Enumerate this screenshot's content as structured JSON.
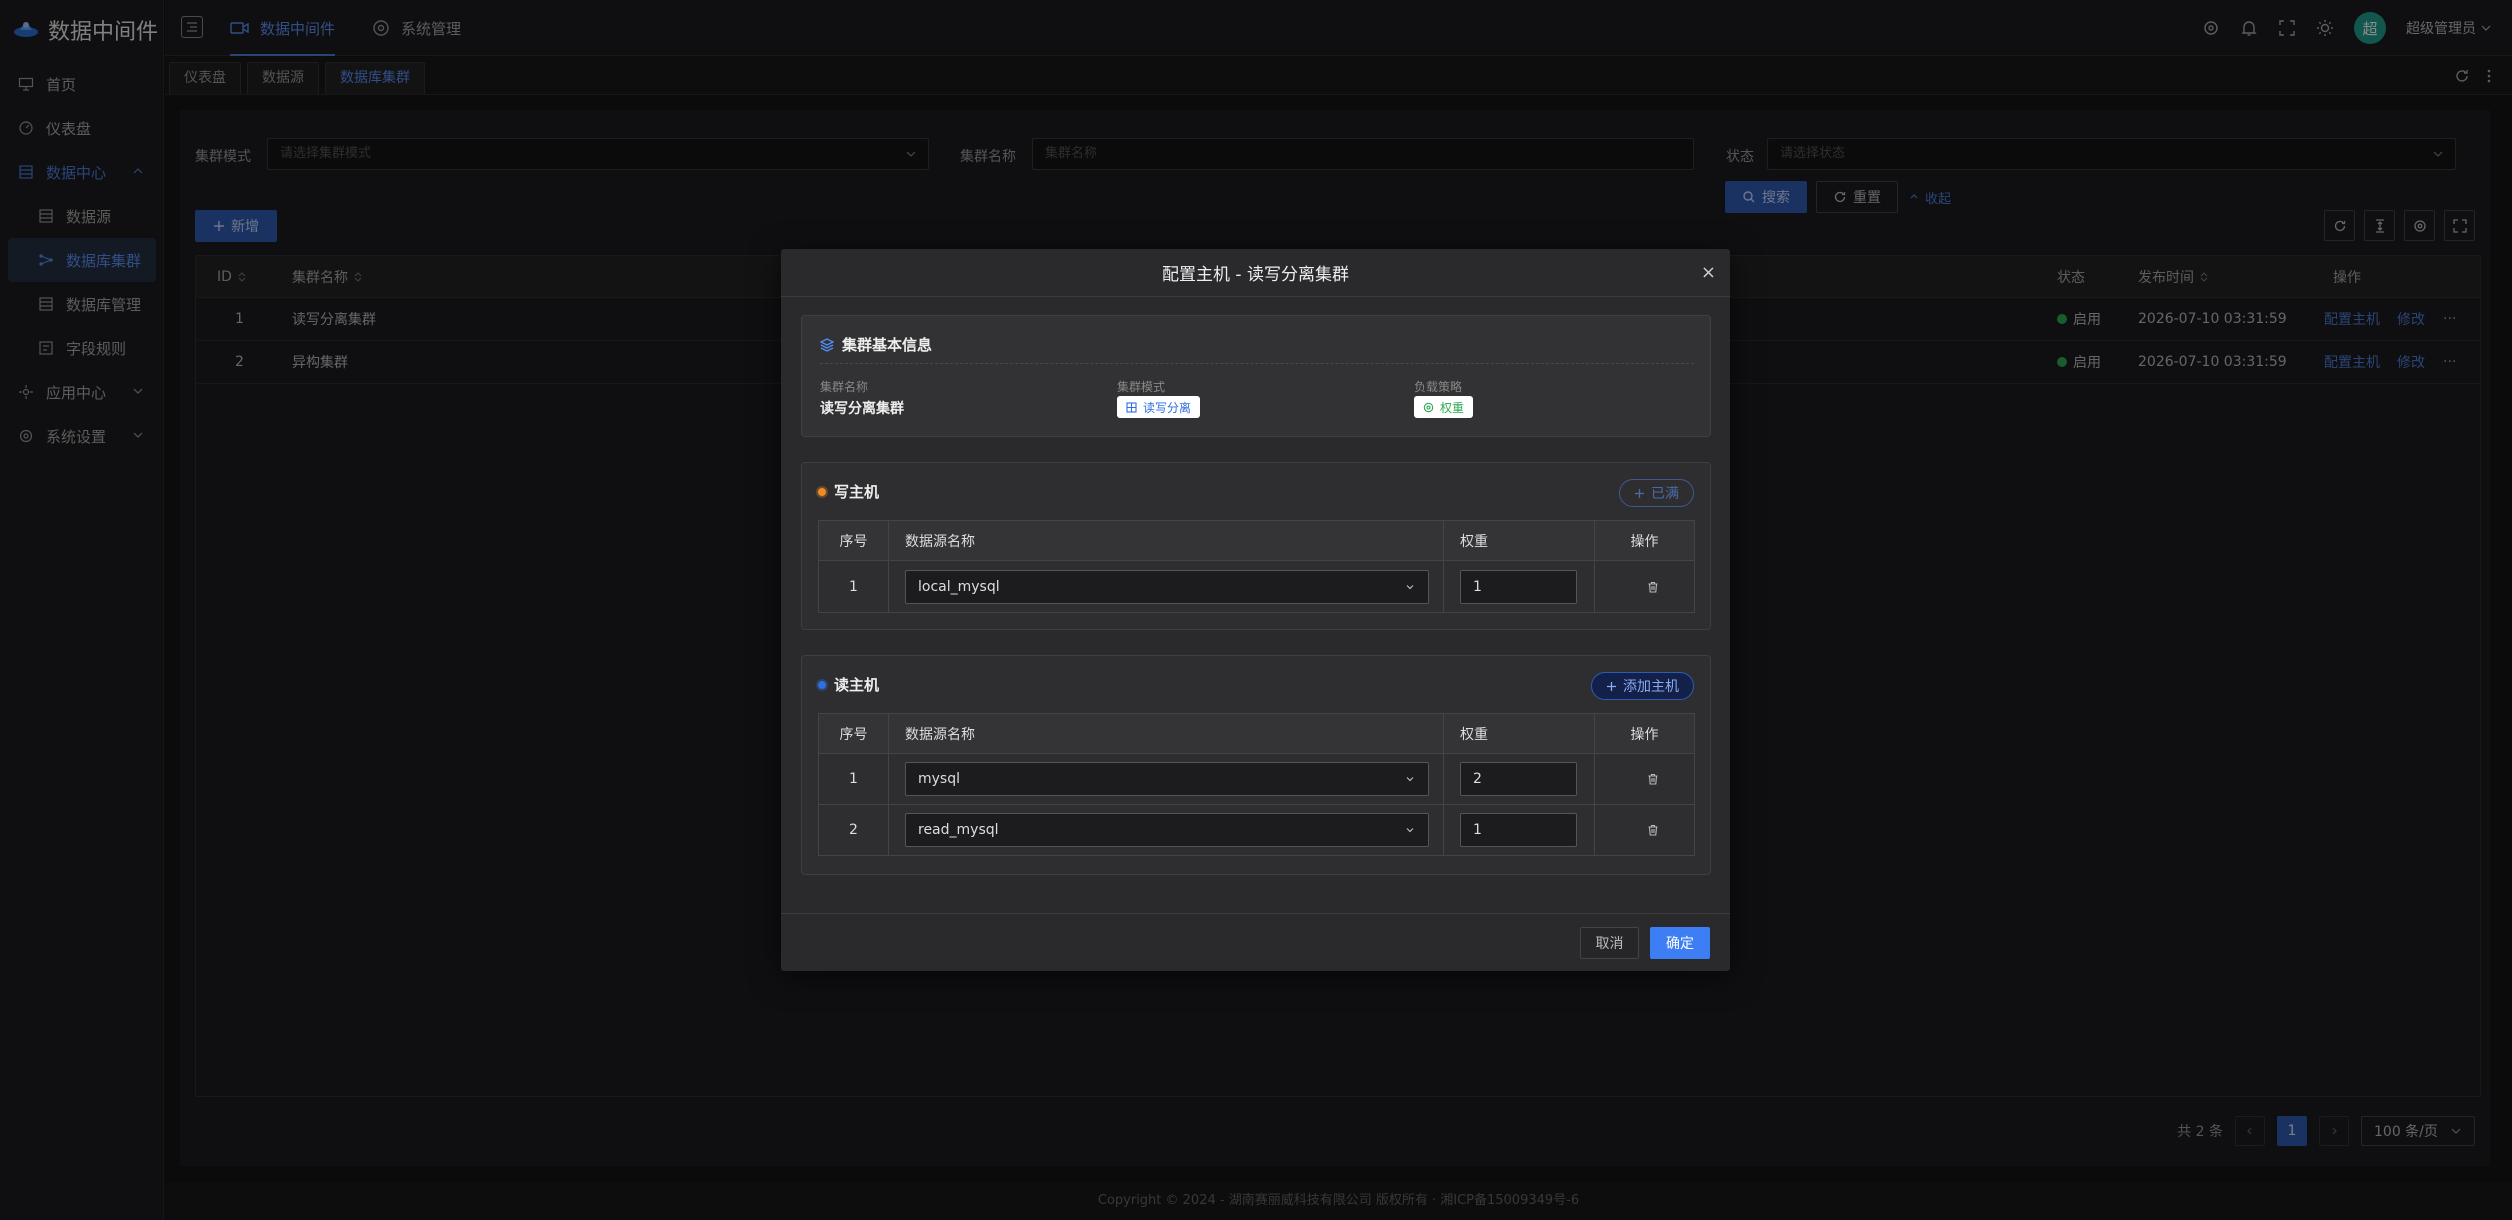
{
  "app": {
    "title": "数据中间件"
  },
  "sidebar": {
    "items": [
      {
        "label": "首页",
        "icon": "monitor-icon"
      },
      {
        "label": "仪表盘",
        "icon": "dashboard-icon"
      },
      {
        "label": "数据中心",
        "icon": "database-icon"
      },
      {
        "label": "数据源",
        "icon": "table-icon"
      },
      {
        "label": "数据库集群",
        "icon": "cluster-icon"
      },
      {
        "label": "数据库管理",
        "icon": "table-icon"
      },
      {
        "label": "字段规则",
        "icon": "rule-icon"
      },
      {
        "label": "应用中心",
        "icon": "apps-icon"
      },
      {
        "label": "系统设置",
        "icon": "gear-icon"
      }
    ]
  },
  "topnav": {
    "items": [
      {
        "label": "数据中间件"
      },
      {
        "label": "系统管理"
      }
    ]
  },
  "user": {
    "avatar": "超",
    "name": "超级管理员"
  },
  "tabs": [
    {
      "label": "仪表盘"
    },
    {
      "label": "数据源"
    },
    {
      "label": "数据库集群"
    }
  ],
  "search": {
    "mode_label": "集群模式",
    "mode_placeholder": "请选择集群模式",
    "name_label": "集群名称",
    "name_placeholder": "集群名称",
    "status_label": "状态",
    "status_placeholder": "请选择状态",
    "search_btn": "搜索",
    "reset_btn": "重置",
    "collapse_btn": "收起"
  },
  "toolbar": {
    "add_btn": "新增"
  },
  "table": {
    "headers": {
      "id": "ID",
      "name": "集群名称",
      "status": "状态",
      "time": "发布时间",
      "ops": "操作"
    },
    "rows": [
      {
        "id": "1",
        "name": "读写分离集群",
        "status": "启用",
        "time": "2026-07-10 03:31:59",
        "op1": "配置主机",
        "op2": "修改",
        "more": "···"
      },
      {
        "id": "2",
        "name": "异构集群",
        "status": "启用",
        "time": "2026-07-10 03:31:59",
        "op1": "配置主机",
        "op2": "修改",
        "more": "···"
      }
    ]
  },
  "pagination": {
    "total": "共 2 条",
    "current": "1",
    "size": "100 条/页"
  },
  "footer": {
    "text": "Copyright © 2024 - 湖南赛丽威科技有限公司 版权所有 · 湘ICP备15009349号-6"
  },
  "modal": {
    "title": "配置主机 - 读写分离集群",
    "close": "×",
    "info": {
      "title": "集群基本信息",
      "name_label": "集群名称",
      "name_value": "读写分离集群",
      "mode_label": "集群模式",
      "mode_value": "读写分离",
      "strategy_label": "负载策略",
      "strategy_value": "权重"
    },
    "write": {
      "title": "写主机",
      "btn": "已满",
      "headers": {
        "seq": "序号",
        "ds": "数据源名称",
        "weight": "权重",
        "op": "操作"
      },
      "rows": [
        {
          "seq": "1",
          "ds": "local_mysql",
          "weight": "1"
        }
      ]
    },
    "read": {
      "title": "读主机",
      "btn": "添加主机",
      "headers": {
        "seq": "序号",
        "ds": "数据源名称",
        "weight": "权重",
        "op": "操作"
      },
      "rows": [
        {
          "seq": "1",
          "ds": "mysql",
          "weight": "2"
        },
        {
          "seq": "2",
          "ds": "read_mysql",
          "weight": "1"
        }
      ]
    },
    "cancel": "取消",
    "confirm": "确定"
  },
  "colors": {
    "accent": "#4d7dd9",
    "write_dot": "#f08a24",
    "read_dot": "#2f6fe0",
    "status_green": "#2eaa50"
  }
}
